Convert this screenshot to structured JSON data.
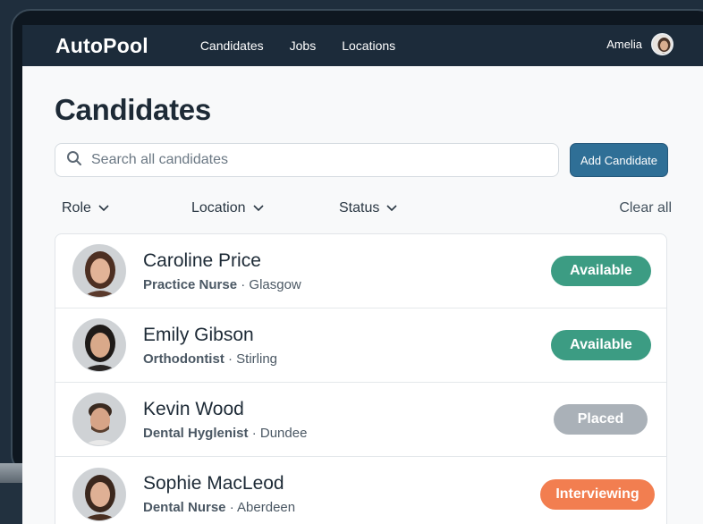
{
  "app": {
    "logo": "AutoPool"
  },
  "nav": [
    "Candidates",
    "Jobs",
    "Locations"
  ],
  "user": {
    "name": "Amelia"
  },
  "page": {
    "title": "Candidates"
  },
  "search": {
    "placeholder": "Search all candidates"
  },
  "actions": {
    "add_label": "Add Candidate"
  },
  "filters": {
    "role": "Role",
    "location": "Location",
    "status": "Status",
    "clear": "Clear all"
  },
  "candidates": [
    {
      "name": "Caroline Price",
      "role": "Practice Nurse",
      "location": "Glasgow",
      "status": "Available",
      "status_color": "#3c9c83"
    },
    {
      "name": "Emily Gibson",
      "role": "Orthodontist",
      "location": "Stirling",
      "status": "Available",
      "status_color": "#3c9c83"
    },
    {
      "name": "Kevin Wood",
      "role": "Dental Hyglenist",
      "location": "Dundee",
      "status": "Placed",
      "status_color": "#aab1b8"
    },
    {
      "name": "Sophie MacLeod",
      "role": "Dental Nurse",
      "location": "Aberdeen",
      "status": "Interviewing",
      "status_color": "#f27e50"
    }
  ],
  "theme": {
    "navbar": "#1c2b3a",
    "accent": "#2f6f96"
  }
}
